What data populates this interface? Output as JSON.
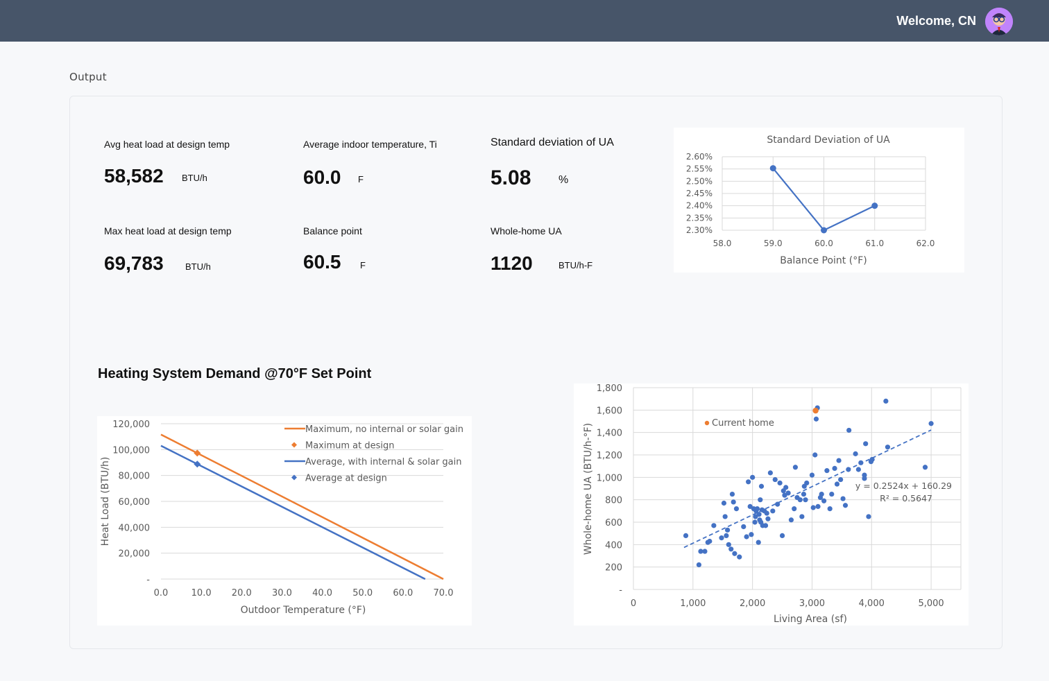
{
  "header": {
    "welcome": "Welcome, CN"
  },
  "section": {
    "title": "Output"
  },
  "metrics": {
    "avg_heat_load": {
      "label": "Avg heat load at design temp",
      "value": "58,582",
      "unit": "BTU/h"
    },
    "avg_indoor_temp": {
      "label": "Average indoor temperature, Ti",
      "value": "60.0",
      "unit": "F"
    },
    "std_ua": {
      "label": "Standard deviation of UA",
      "value": "5.08",
      "unit": "%"
    },
    "max_heat_load": {
      "label": "Max heat load at design temp",
      "value": "69,783",
      "unit": "BTU/h"
    },
    "balance_point": {
      "label": "Balance point",
      "value": "60.5",
      "unit": "F"
    },
    "whole_home_ua": {
      "label": "Whole-home UA",
      "value": "1120",
      "unit": "BTU/h-F"
    }
  },
  "demand_heading": "Heating System Demand @70°F Set Point",
  "chart_data": [
    {
      "type": "line",
      "title": "Standard Deviation of UA",
      "xlabel": "Balance Point (°F)",
      "ylabel": "",
      "xlim": [
        58.0,
        62.0
      ],
      "ylim": [
        2.3,
        2.6
      ],
      "x_ticks": [
        "58.0",
        "59.0",
        "60.0",
        "61.0",
        "62.0"
      ],
      "y_ticks": [
        "2.30%",
        "2.35%",
        "2.40%",
        "2.45%",
        "2.50%",
        "2.55%",
        "2.60%"
      ],
      "grid": true,
      "series": [
        {
          "x": [
            59.0,
            60.0,
            61.0
          ],
          "y": [
            2.553,
            2.3,
            2.4
          ],
          "color": "#4472c4"
        }
      ]
    },
    {
      "type": "line",
      "title": "",
      "xlabel": "Outdoor Temperature (°F)",
      "ylabel": "Heat Load (BTU/h)",
      "xlim": [
        0,
        70
      ],
      "ylim": [
        0,
        120000
      ],
      "x_ticks": [
        "0.0",
        "10.0",
        "20.0",
        "30.0",
        "40.0",
        "50.0",
        "60.0",
        "70.0"
      ],
      "y_ticks": [
        "-",
        "20,000",
        "40,000",
        "60,000",
        "80,000",
        "100,000",
        "120,000"
      ],
      "grid": true,
      "legend_position": "top-right",
      "series": [
        {
          "name": "Maximum, no internal or solar gain",
          "x": [
            0,
            70
          ],
          "y": [
            111650,
            0
          ],
          "color": "#ed7d31"
        },
        {
          "name": "Maximum at design",
          "x": [
            9
          ],
          "y": [
            97300
          ],
          "color": "#ed7d31",
          "marker": "diamond"
        },
        {
          "name": "Average, with internal & solar gain",
          "x": [
            0,
            65.5
          ],
          "y": [
            103000,
            0
          ],
          "color": "#4472c4"
        },
        {
          "name": "Average at design",
          "x": [
            9
          ],
          "y": [
            88800
          ],
          "color": "#4472c4",
          "marker": "diamond"
        }
      ]
    },
    {
      "type": "scatter",
      "title": "",
      "xlabel": "Living Area (sf)",
      "ylabel": "Whole-home UA (BTU/h-°F)",
      "xlim": [
        0,
        5500
      ],
      "ylim": [
        0,
        1800
      ],
      "x_ticks": [
        "0",
        "1,000",
        "2,000",
        "3,000",
        "4,000",
        "5,000"
      ],
      "y_ticks": [
        "-",
        "200",
        "400",
        "600",
        "800",
        "1,000",
        "1,200",
        "1,400",
        "1,600",
        "1,800"
      ],
      "grid": true,
      "trendline": {
        "slope": 0.2524,
        "intercept": 160.29,
        "x_range": [
          850,
          5000
        ],
        "equation": "y = 0.2524x + 160.29",
        "r2": "R² = 0.5647"
      },
      "legend": "Current home",
      "current_home": {
        "x": 3060,
        "y": 1595
      },
      "points": [
        [
          880,
          480
        ],
        [
          1100,
          220
        ],
        [
          1130,
          340
        ],
        [
          1200,
          340
        ],
        [
          1250,
          420
        ],
        [
          1280,
          430
        ],
        [
          1350,
          570
        ],
        [
          1480,
          460
        ],
        [
          1520,
          770
        ],
        [
          1540,
          650
        ],
        [
          1560,
          480
        ],
        [
          1580,
          530
        ],
        [
          1600,
          400
        ],
        [
          1640,
          360
        ],
        [
          1660,
          850
        ],
        [
          1680,
          780
        ],
        [
          1700,
          320
        ],
        [
          1730,
          720
        ],
        [
          1780,
          290
        ],
        [
          1850,
          560
        ],
        [
          1900,
          470
        ],
        [
          1930,
          960
        ],
        [
          1960,
          740
        ],
        [
          1980,
          490
        ],
        [
          2000,
          1000
        ],
        [
          2020,
          720
        ],
        [
          2040,
          600
        ],
        [
          2050,
          650
        ],
        [
          2060,
          700
        ],
        [
          2080,
          720
        ],
        [
          2100,
          420
        ],
        [
          2110,
          670
        ],
        [
          2120,
          620
        ],
        [
          2130,
          800
        ],
        [
          2140,
          600
        ],
        [
          2150,
          920
        ],
        [
          2160,
          710
        ],
        [
          2170,
          570
        ],
        [
          2200,
          700
        ],
        [
          2220,
          570
        ],
        [
          2240,
          680
        ],
        [
          2260,
          630
        ],
        [
          2300,
          1040
        ],
        [
          2340,
          700
        ],
        [
          2380,
          980
        ],
        [
          2420,
          760
        ],
        [
          2460,
          950
        ],
        [
          2500,
          480
        ],
        [
          2520,
          880
        ],
        [
          2540,
          840
        ],
        [
          2560,
          910
        ],
        [
          2600,
          860
        ],
        [
          2650,
          620
        ],
        [
          2700,
          720
        ],
        [
          2720,
          1090
        ],
        [
          2750,
          820
        ],
        [
          2800,
          800
        ],
        [
          2830,
          650
        ],
        [
          2860,
          850
        ],
        [
          2870,
          920
        ],
        [
          2890,
          800
        ],
        [
          2910,
          950
        ],
        [
          3000,
          1020
        ],
        [
          3020,
          730
        ],
        [
          3050,
          1200
        ],
        [
          3070,
          1520
        ],
        [
          3090,
          1620
        ],
        [
          3100,
          740
        ],
        [
          3140,
          820
        ],
        [
          3160,
          850
        ],
        [
          3200,
          790
        ],
        [
          3250,
          1060
        ],
        [
          3300,
          720
        ],
        [
          3330,
          850
        ],
        [
          3380,
          1080
        ],
        [
          3420,
          940
        ],
        [
          3450,
          1150
        ],
        [
          3480,
          980
        ],
        [
          3520,
          810
        ],
        [
          3560,
          750
        ],
        [
          3620,
          1420
        ],
        [
          3730,
          1210
        ],
        [
          3780,
          1070
        ],
        [
          3820,
          1130
        ],
        [
          3880,
          1020
        ],
        [
          3900,
          1300
        ],
        [
          3950,
          650
        ],
        [
          3990,
          1140
        ],
        [
          4010,
          1160
        ],
        [
          4240,
          1680
        ],
        [
          4270,
          1270
        ],
        [
          4900,
          1090
        ],
        [
          5000,
          1480
        ],
        [
          3880,
          990
        ],
        [
          3610,
          1070
        ]
      ]
    }
  ]
}
